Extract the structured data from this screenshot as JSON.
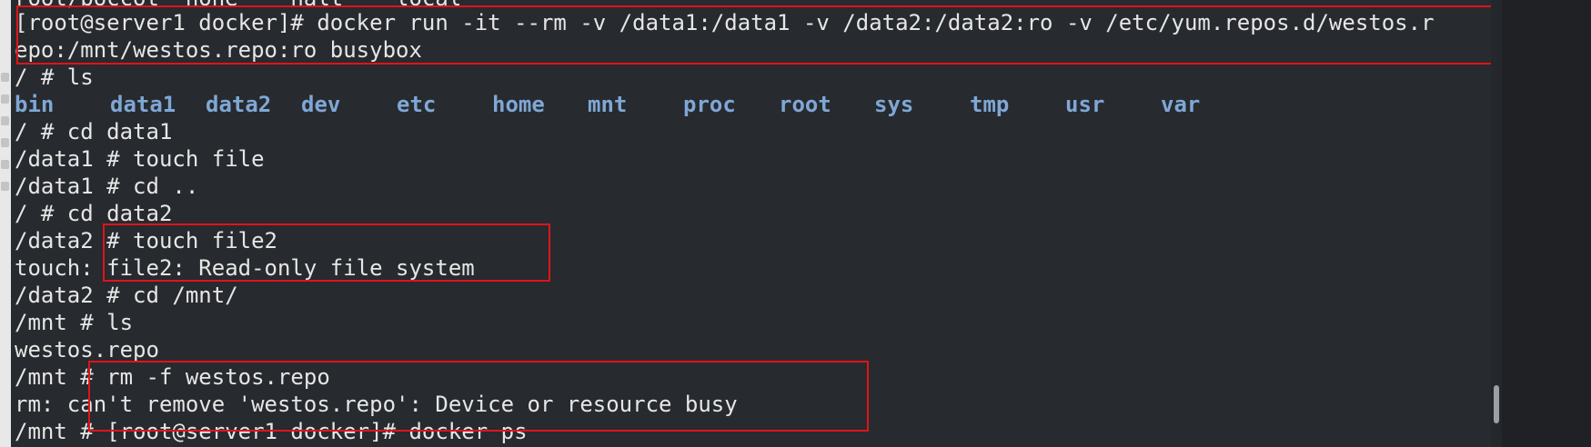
{
  "terminal": {
    "top_partial": "root/boccot  none    halt    local",
    "command_line_1": "[root@server1 docker]# docker run -it --rm -v /data1:/data1 -v /data2:/data2:ro -v /etc/yum.repos.d/westos.r",
    "command_line_2": "epo:/mnt/westos.repo:ro busybox",
    "ls_cmd": "/ # ls",
    "dirs": [
      "bin",
      "data1",
      "data2",
      "dev",
      "etc",
      "home",
      "mnt",
      "proc",
      "root",
      "sys",
      "tmp",
      "usr",
      "var"
    ],
    "cd_data1": "/ # cd data1",
    "touch_file": "/data1 # touch file",
    "cd_up": "/data1 # cd ..",
    "cd_data2": "/ # cd data2",
    "touch_file2": "/data2 # touch file2",
    "touch_error": "touch: file2: Read-only file system",
    "cd_mnt": "/data2 # cd /mnt/",
    "ls_mnt": "/mnt # ls",
    "mnt_listing": "westos.repo",
    "rm_cmd": "/mnt # rm -f westos.repo",
    "rm_error": "rm: can't remove 'westos.repo': Device or resource busy",
    "last_line": "/mnt # [root@server1 docker]# docker ps"
  },
  "colors": {
    "background": "#272a2e",
    "text": "#e6e6e6",
    "directory": "#7fa7d6",
    "highlight_box": "#e0141a"
  }
}
